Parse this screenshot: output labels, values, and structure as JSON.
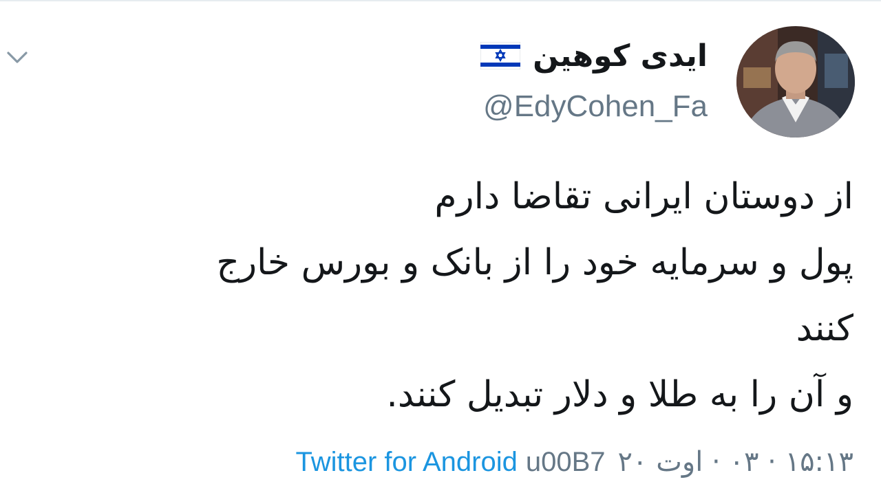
{
  "tweet": {
    "author": {
      "display_name": "ایدی کوهین",
      "handle": "@EdyCohen_Fa",
      "flag_icon": "israel-flag-icon",
      "avatar_icon": "profile-photo"
    },
    "body_lines": [
      "از دوستان ایرانی تقاضا دارم",
      "پول و سرمایه خود را از بانک و بورس خارج",
      "کنند",
      "و آن را به طلا و دلار تبدیل کنند."
    ],
    "meta": {
      "timestamp": "۱۵:۱۳ · ۰۳ · اوت ۲۰",
      "separator": "u00B7",
      "source": "Twitter for Android"
    },
    "menu_icon": "chevron-down-icon"
  },
  "colors": {
    "background": "#ffffff",
    "text": "#14171a",
    "secondary": "#657786",
    "link": "#1b95e0",
    "flag_blue": "#0038b8"
  }
}
